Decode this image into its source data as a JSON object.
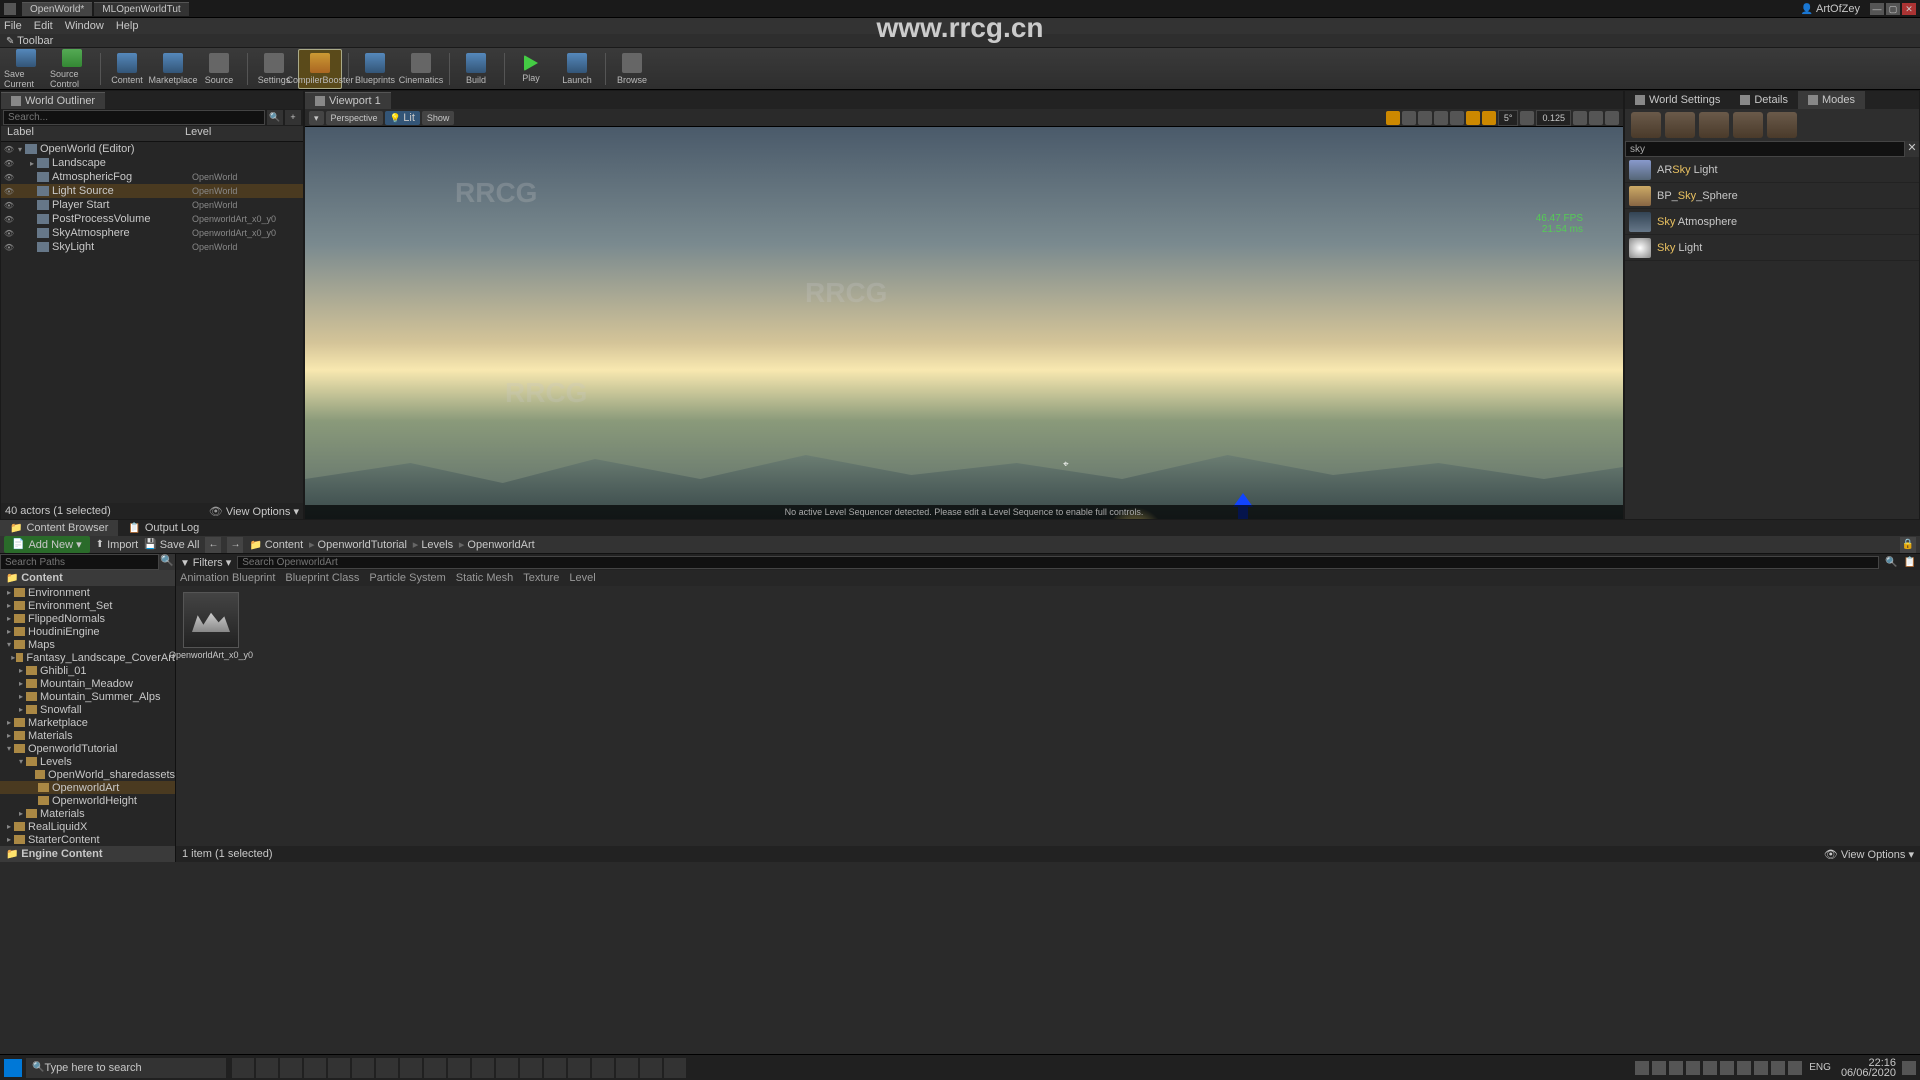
{
  "titlebar": {
    "tabs": [
      "OpenWorld*",
      "MLOpenWorldTut"
    ],
    "user": "ArtOfZey"
  },
  "menubar": [
    "File",
    "Edit",
    "Window",
    "Help"
  ],
  "toolbar_label": "Toolbar",
  "toolbar": [
    {
      "label": "Save Current",
      "icon": "blue"
    },
    {
      "label": "Source Control",
      "icon": "green"
    },
    {
      "sep": true
    },
    {
      "label": "Content",
      "icon": "blue"
    },
    {
      "label": "Marketplace",
      "icon": "blue"
    },
    {
      "label": "Source",
      "icon": "gray"
    },
    {
      "sep": true
    },
    {
      "label": "Settings",
      "icon": "gray"
    },
    {
      "label": "CompilerBooster",
      "icon": "orange",
      "active": true
    },
    {
      "sep": true
    },
    {
      "label": "Blueprints",
      "icon": "blue"
    },
    {
      "label": "Cinematics",
      "icon": "gray"
    },
    {
      "sep": true
    },
    {
      "label": "Build",
      "icon": "blue"
    },
    {
      "sep": true
    },
    {
      "label": "Play",
      "icon": "play"
    },
    {
      "label": "Launch",
      "icon": "blue"
    },
    {
      "sep": true
    },
    {
      "label": "Browse",
      "icon": "gray"
    }
  ],
  "outliner": {
    "title": "World Outliner",
    "search_placeholder": "Search...",
    "columns": [
      "Label",
      "Level"
    ],
    "rows": [
      {
        "indent": 0,
        "arrow": "▾",
        "label": "OpenWorld (Editor)",
        "type": ""
      },
      {
        "indent": 1,
        "arrow": "▸",
        "label": "Landscape",
        "type": ""
      },
      {
        "indent": 1,
        "arrow": "",
        "label": "AtmosphericFog",
        "type": "OpenWorld"
      },
      {
        "indent": 1,
        "arrow": "",
        "label": "Light Source",
        "type": "OpenWorld",
        "selected": true
      },
      {
        "indent": 1,
        "arrow": "",
        "label": "Player Start",
        "type": "OpenWorld"
      },
      {
        "indent": 1,
        "arrow": "",
        "label": "PostProcessVolume",
        "type": "OpenworldArt_x0_y0"
      },
      {
        "indent": 1,
        "arrow": "",
        "label": "SkyAtmosphere",
        "type": "OpenworldArt_x0_y0"
      },
      {
        "indent": 1,
        "arrow": "",
        "label": "SkyLight",
        "type": "OpenWorld"
      }
    ],
    "status": "40 actors (1 selected)",
    "view_options": "View Options ▾"
  },
  "viewport": {
    "tab": "Viewport 1",
    "btns_left": [
      "▾",
      "Perspective",
      "Lit",
      "Show"
    ],
    "right_nums": {
      "angle": "5°",
      "snap": "0.125"
    },
    "fps": "46.47 FPS\n21.54 ms",
    "seqbar": "No active Level Sequencer detected. Please edit a Level Sequence to enable full controls."
  },
  "right": {
    "tabs": [
      "World Settings",
      "Details",
      "Modes"
    ],
    "active_tab": 2,
    "search_value": "sky",
    "items": [
      {
        "label_pre": "AR",
        "hl": "Sky",
        "label_post": " Light",
        "thumb": "sky"
      },
      {
        "label_pre": "BP_",
        "hl": "Sky",
        "label_post": "_Sphere",
        "thumb": "sphere"
      },
      {
        "label_pre": "",
        "hl": "Sky",
        "label_post": " Atmosphere",
        "thumb": "atmo"
      },
      {
        "label_pre": "",
        "hl": "Sky",
        "label_post": " Light",
        "thumb": "light"
      }
    ]
  },
  "content_browser": {
    "tabs": [
      "Content Browser",
      "Output Log"
    ],
    "addnew": "Add New ▾",
    "import": "Import",
    "saveall": "Save All",
    "crumbs": [
      "Content",
      "OpenworldTutorial",
      "Levels",
      "OpenworldArt"
    ],
    "tree_search_placeholder": "Search Paths",
    "tree_header": "Content",
    "tree": [
      {
        "indent": 0,
        "arrow": "▸",
        "label": "Environment"
      },
      {
        "indent": 0,
        "arrow": "▸",
        "label": "Environment_Set"
      },
      {
        "indent": 0,
        "arrow": "▸",
        "label": "FlippedNormals"
      },
      {
        "indent": 0,
        "arrow": "▸",
        "label": "HoudiniEngine"
      },
      {
        "indent": 0,
        "arrow": "▾",
        "label": "Maps"
      },
      {
        "indent": 1,
        "arrow": "▸",
        "label": "Fantasy_Landscape_CoverArt"
      },
      {
        "indent": 1,
        "arrow": "▸",
        "label": "Ghibli_01"
      },
      {
        "indent": 1,
        "arrow": "▸",
        "label": "Mountain_Meadow"
      },
      {
        "indent": 1,
        "arrow": "▸",
        "label": "Mountain_Summer_Alps"
      },
      {
        "indent": 1,
        "arrow": "▸",
        "label": "Snowfall"
      },
      {
        "indent": 0,
        "arrow": "▸",
        "label": "Marketplace"
      },
      {
        "indent": 0,
        "arrow": "▸",
        "label": "Materials"
      },
      {
        "indent": 0,
        "arrow": "▾",
        "label": "OpenworldTutorial"
      },
      {
        "indent": 1,
        "arrow": "▾",
        "label": "Levels"
      },
      {
        "indent": 2,
        "arrow": "",
        "label": "OpenWorld_sharedassets"
      },
      {
        "indent": 2,
        "arrow": "",
        "label": "OpenworldArt",
        "sel": true
      },
      {
        "indent": 2,
        "arrow": "",
        "label": "OpenworldHeight"
      },
      {
        "indent": 1,
        "arrow": "▸",
        "label": "Materials"
      },
      {
        "indent": 0,
        "arrow": "▸",
        "label": "RealLiquidX"
      },
      {
        "indent": 0,
        "arrow": "▸",
        "label": "StarterContent"
      }
    ],
    "tree_footer": "Engine Content",
    "filters_label": "Filters ▾",
    "asset_search_placeholder": "Search OpenworldArt",
    "chips": [
      "Animation Blueprint",
      "Blueprint Class",
      "Particle System",
      "Static Mesh",
      "Texture",
      "Level"
    ],
    "assets": [
      {
        "label": "OpenworldArt_x0_y0"
      }
    ],
    "status": "1 item (1 selected)",
    "view_options": "View Options ▾"
  },
  "taskbar": {
    "search_placeholder": "Type here to search",
    "lang": "ENG",
    "time": "22:16",
    "date": "06/06/2020"
  },
  "watermark_url": "www.rrcg.cn"
}
